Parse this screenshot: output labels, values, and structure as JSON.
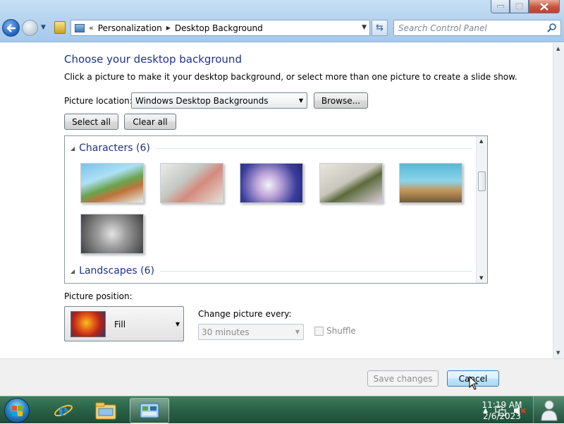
{
  "window": {
    "minimize_icon": "minimize-icon",
    "maximize_icon": "maximize-icon",
    "close_icon": "close-icon"
  },
  "address": {
    "overflow": "«",
    "crumbs": [
      "Personalization",
      "Desktop Background"
    ]
  },
  "search": {
    "placeholder": "Search Control Panel"
  },
  "main": {
    "title": "Choose your desktop background",
    "description": "Click a picture to make it your desktop background, or select more than one picture to create a slide show.",
    "picture_location_label": "Picture location:",
    "picture_location_value": "Windows Desktop Backgrounds",
    "browse_label": "Browse...",
    "select_all_label": "Select all",
    "clear_all_label": "Clear all"
  },
  "gallery": {
    "groups": [
      {
        "name": "Characters (6)",
        "thumbnails": 6
      },
      {
        "name": "Landscapes (6)"
      }
    ]
  },
  "position": {
    "label": "Picture position:",
    "value": "Fill",
    "change_label": "Change picture every:",
    "interval_value": "30 minutes",
    "shuffle_label": "Shuffle",
    "shuffle_checked": false
  },
  "footer": {
    "save_label": "Save changes",
    "cancel_label": "Cancel"
  },
  "taskbar": {
    "time": "11:19 AM",
    "date": "2/6/2023",
    "pinned": [
      "internet-explorer-icon",
      "windows-explorer-icon",
      "control-panel-icon"
    ]
  },
  "colors": {
    "title_blue": "#1e3287",
    "taskbar_green": "#2b6448"
  }
}
